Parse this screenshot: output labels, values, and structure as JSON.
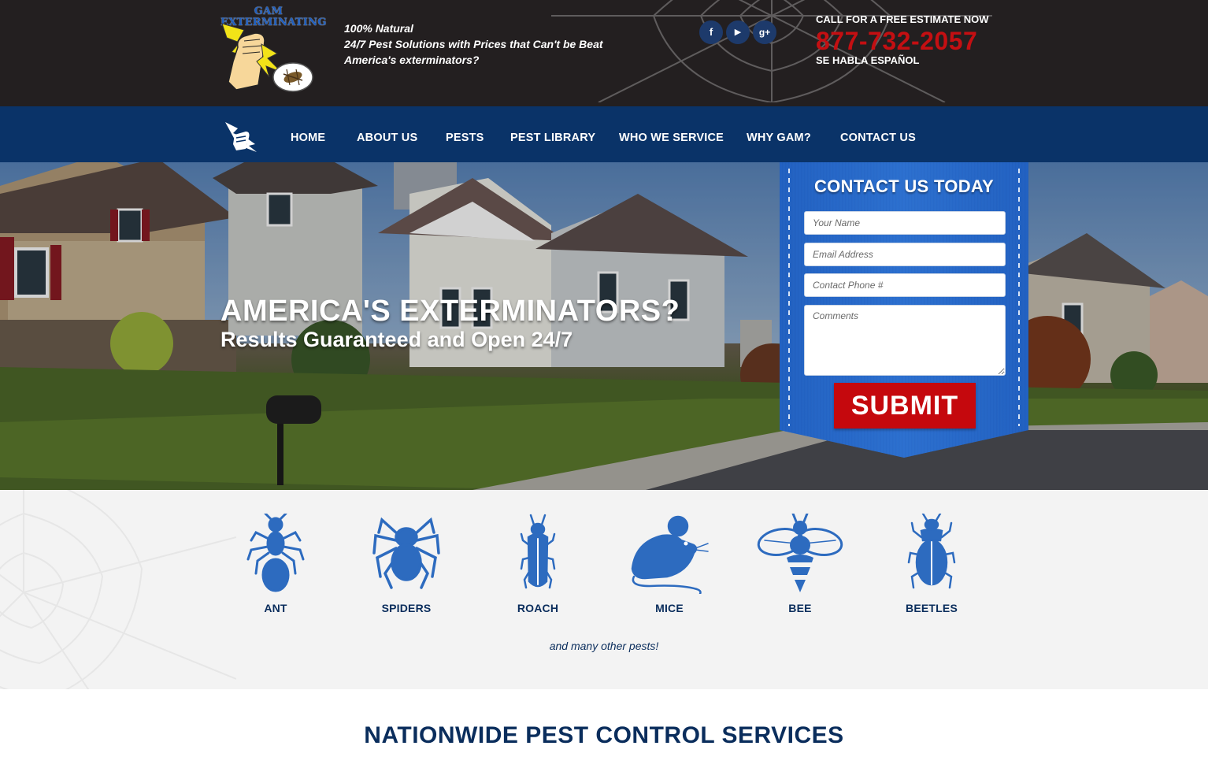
{
  "header": {
    "logo_text": "GAM EXTERMINATING",
    "tagline": [
      "100% Natural",
      "24/7 Pest Solutions with Prices that Can't be Beat",
      "America's exterminators?"
    ],
    "social": [
      {
        "name": "facebook",
        "glyph": "f"
      },
      {
        "name": "youtube",
        "glyph": "▶"
      },
      {
        "name": "google-plus",
        "glyph": "g+"
      }
    ],
    "cta_label": "CALL FOR A FREE ESTIMATE NOW",
    "phone": "877-732-2057",
    "spanish": "SE HABLA ESPAÑOL"
  },
  "nav": {
    "items": [
      "HOME",
      "ABOUT US",
      "PESTS",
      "PEST LIBRARY",
      "WHO WE SERVICE",
      "WHY GAM?",
      "CONTACT US"
    ]
  },
  "hero": {
    "headline": "AMERICA'S EXTERMINATORS?",
    "subheadline": "Results Guaranteed and Open 24/7"
  },
  "contact_form": {
    "title": "CONTACT US TODAY",
    "name_placeholder": "Your Name",
    "email_placeholder": "Email Address",
    "phone_placeholder": "Contact Phone #",
    "comments_placeholder": "Comments",
    "submit_label": "SUBMIT"
  },
  "pests": {
    "items": [
      {
        "label": "ANT",
        "icon": "ant-icon"
      },
      {
        "label": "SPIDERS",
        "icon": "spider-icon"
      },
      {
        "label": "ROACH",
        "icon": "roach-icon"
      },
      {
        "label": "MICE",
        "icon": "mouse-icon"
      },
      {
        "label": "BEE",
        "icon": "bee-icon"
      },
      {
        "label": "BEETLES",
        "icon": "beetle-icon"
      }
    ],
    "note": "and many other pests!"
  },
  "section": {
    "title": "NATIONWIDE PEST CONTROL SERVICES"
  },
  "colors": {
    "topbar": "#231f20",
    "nav": "#0a3368",
    "accent_red": "#c40f12",
    "pest_blue": "#2d6bbf",
    "heading_navy": "#0a2d5c"
  }
}
